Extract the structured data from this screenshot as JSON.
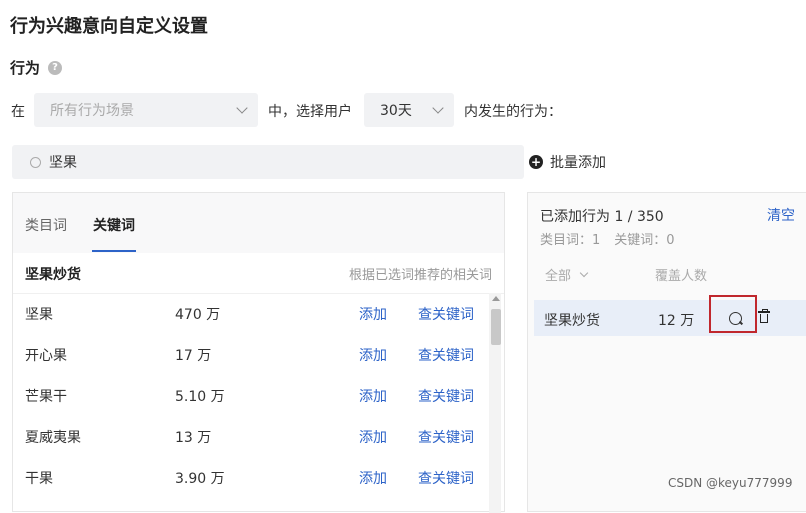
{
  "page": {
    "title": "行为兴趣意向自定义设置",
    "section_label": "行为",
    "help_icon": "question-circle-icon"
  },
  "behavior_row": {
    "prefix": "在",
    "scene_select": "所有行为场景",
    "middle": "中，选择用户",
    "days_select": "30天",
    "suffix": "内发生的行为："
  },
  "search": {
    "value": "坚果"
  },
  "batch_add": {
    "label": "批量添加"
  },
  "left_panel": {
    "tabs": [
      {
        "label": "类目词"
      },
      {
        "label": "关键词"
      }
    ],
    "active_tab": "关键词",
    "list_title": "坚果炒货",
    "list_hint": "根据已选词推荐的相关词",
    "rows": [
      {
        "keyword": "坚果",
        "count": "470 万",
        "add": "添加",
        "look": "查关键词"
      },
      {
        "keyword": "开心果",
        "count": "17 万",
        "add": "添加",
        "look": "查关键词"
      },
      {
        "keyword": "芒果干",
        "count": "5.10 万",
        "add": "添加",
        "look": "查关键词"
      },
      {
        "keyword": "夏威夷果",
        "count": "13 万",
        "add": "添加",
        "look": "查关键词"
      },
      {
        "keyword": "干果",
        "count": "3.90 万",
        "add": "添加",
        "look": "查关键词"
      }
    ]
  },
  "right_panel": {
    "added_text": "已添加行为 1 / 350",
    "clear_label": "清空",
    "stat_category": "类目词：1",
    "stat_keyword": "关键词：0",
    "filter_all": "全部",
    "cover_label": "覆盖人数",
    "item": {
      "keyword": "坚果炒货",
      "count": "12 万"
    }
  },
  "watermark": "CSDN @keyu777999",
  "colors": {
    "accent": "#2d63c8",
    "highlight": "#c0272d"
  }
}
